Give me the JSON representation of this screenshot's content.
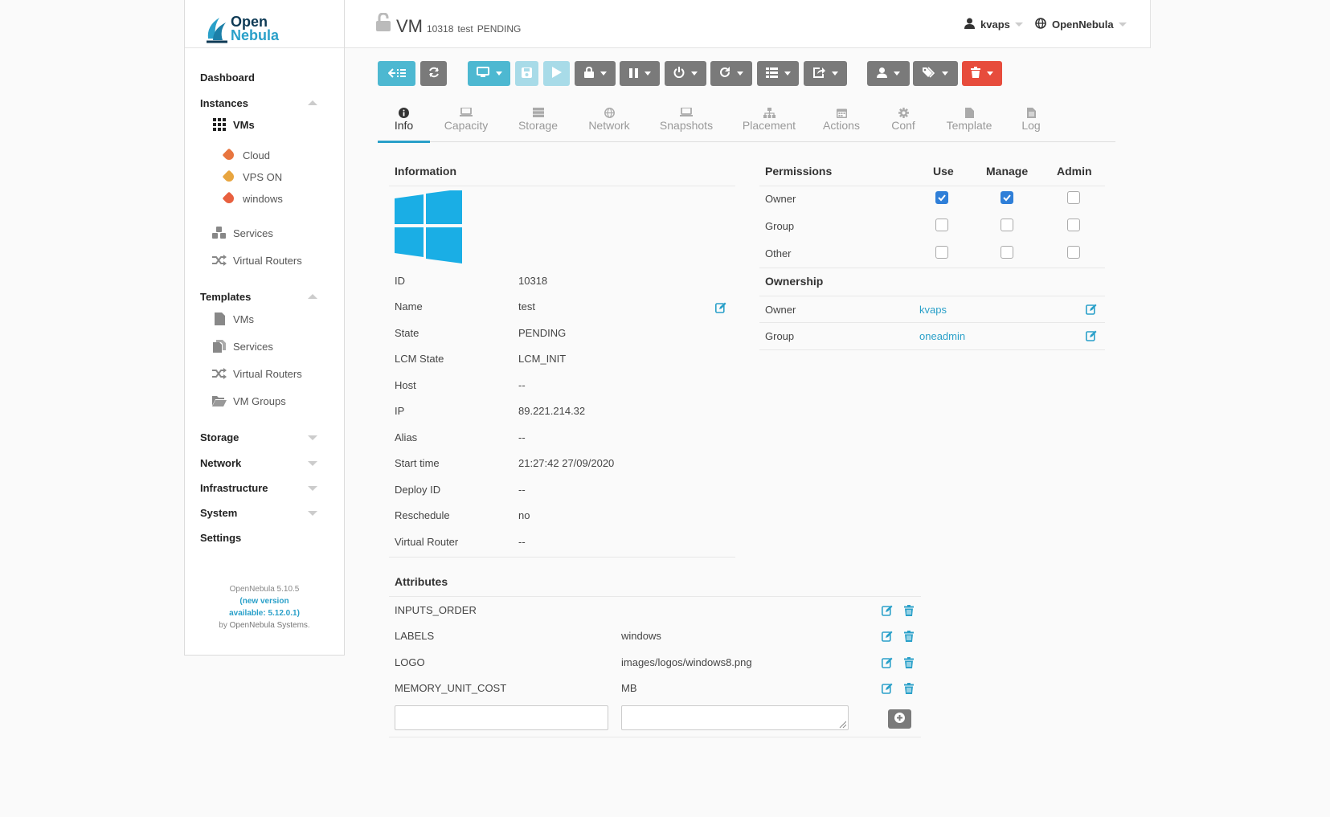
{
  "brand": {
    "line1": "Open",
    "line2": "Nebula"
  },
  "sidebar": {
    "dashboard": "Dashboard",
    "instances": "Instances",
    "vms": "VMs",
    "labels": [
      "Cloud",
      "VPS ON",
      "windows"
    ],
    "label_colors": [
      "#e8753f",
      "#e8a53f",
      "#e8603f"
    ],
    "services": "Services",
    "virtual_routers": "Virtual Routers",
    "templates": "Templates",
    "tpl_vms": "VMs",
    "tpl_services": "Services",
    "tpl_virtual_routers": "Virtual Routers",
    "tpl_vm_groups": "VM Groups",
    "storage": "Storage",
    "network": "Network",
    "infrastructure": "Infrastructure",
    "system": "System",
    "settings": "Settings"
  },
  "version": {
    "line1": "OpenNebula 5.10.5",
    "update": "(new version available: 5.12.0.1)",
    "by": "by",
    "company": "OpenNebula Systems",
    "dot": "."
  },
  "header": {
    "title": "VM",
    "id": "10318",
    "name": "test",
    "state": "PENDING",
    "user": "kvaps",
    "zone": "OpenNebula"
  },
  "tabs": [
    "Info",
    "Capacity",
    "Storage",
    "Network",
    "Snapshots",
    "Placement",
    "Actions",
    "Conf",
    "Template",
    "Log"
  ],
  "info": {
    "heading": "Information",
    "rows": [
      {
        "label": "ID",
        "value": "10318"
      },
      {
        "label": "Name",
        "value": "test"
      },
      {
        "label": "State",
        "value": "PENDING"
      },
      {
        "label": "LCM State",
        "value": "LCM_INIT"
      },
      {
        "label": "Host",
        "value": "--"
      },
      {
        "label": "IP",
        "value": "89.221.214.32"
      },
      {
        "label": "Alias",
        "value": "--"
      },
      {
        "label": "Start time",
        "value": "21:27:42 27/09/2020"
      },
      {
        "label": "Deploy ID",
        "value": "--"
      },
      {
        "label": "Reschedule",
        "value": "no"
      },
      {
        "label": "Virtual Router",
        "value": "--"
      }
    ]
  },
  "permissions": {
    "heading": "Permissions",
    "use": "Use",
    "manage": "Manage",
    "admin": "Admin",
    "rows": [
      {
        "label": "Owner",
        "use": true,
        "manage": true,
        "admin": false
      },
      {
        "label": "Group",
        "use": false,
        "manage": false,
        "admin": false
      },
      {
        "label": "Other",
        "use": false,
        "manage": false,
        "admin": false
      }
    ]
  },
  "ownership": {
    "heading": "Ownership",
    "owner_label": "Owner",
    "owner": "kvaps",
    "group_label": "Group",
    "group": "oneadmin"
  },
  "attributes": {
    "heading": "Attributes",
    "rows": [
      {
        "key": "INPUTS_ORDER",
        "value": ""
      },
      {
        "key": "LABELS",
        "value": "windows"
      },
      {
        "key": "LOGO",
        "value": "images/logos/windows8.png"
      },
      {
        "key": "MEMORY_UNIT_COST",
        "value": "MB"
      }
    ]
  }
}
